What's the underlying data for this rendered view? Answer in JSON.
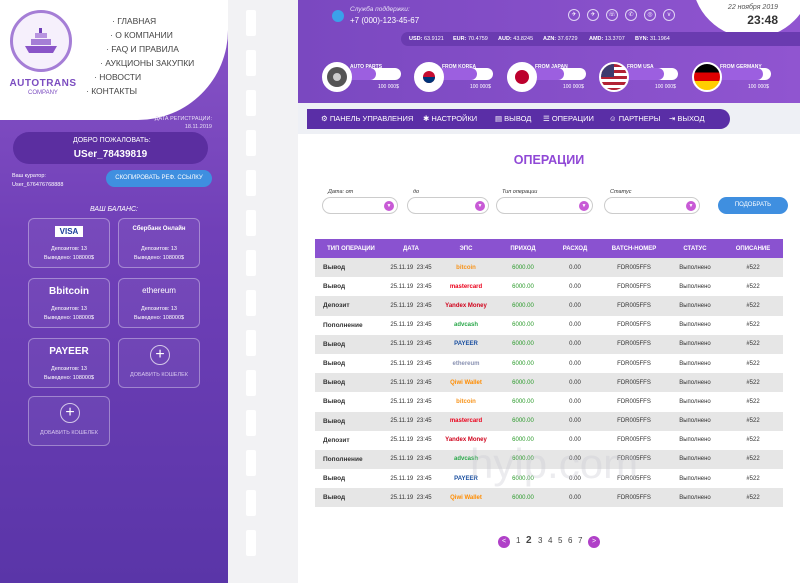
{
  "brand": {
    "title": "AUTOTRANS",
    "subtitle": "COMPANY"
  },
  "nav": [
    "· ГЛАВНАЯ",
    "· О КОМПАНИИ",
    "· FAQ И ПРАВИЛА",
    "· АУКЦИОНЫ ЗАКУПКИ",
    "· НОВОСТИ",
    "· КОНТАКТЫ"
  ],
  "account": {
    "reg_label": "ДАТА РЕГИСТРАЦИИ:",
    "reg_date": "18.11.2019",
    "welcome": "ДОБРО ПОЖАЛОВАТЬ:",
    "username": "USer_78439819",
    "curator_label": "Ваш куратор:",
    "curator": "User_676476768888",
    "copy_ref": "СКОПИРОВАТЬ РЕФ. ССЫЛКУ",
    "balance_label": "ВАШ БАЛАНС:"
  },
  "wallets": [
    {
      "logo": "VISA",
      "deposits": "Депозитов: 13",
      "withdrawn": "Выведено: 108000$"
    },
    {
      "logo": "Сбербанк Онлайн",
      "deposits": "Депозитов: 13",
      "withdrawn": "Выведено: 108000$"
    },
    {
      "logo": "Bbitcoin",
      "deposits": "Депозитов: 13",
      "withdrawn": "Выведено: 108000$"
    },
    {
      "logo": "ethereum",
      "deposits": "Депозитов: 13",
      "withdrawn": "Выведено: 108000$"
    },
    {
      "logo": "PAYEER",
      "deposits": "Депозитов: 13",
      "withdrawn": "Выведено: 108000$"
    }
  ],
  "add_wallet": "ДОБАВИТЬ КОШЕЛЕК",
  "support": {
    "label": "Служба поддержки:",
    "phone": "+7 (000)-123-45-67"
  },
  "socials": [
    "tg",
    "tg",
    "vb",
    "wa",
    "ig",
    "vk"
  ],
  "datetime": {
    "date": "22 ноября 2019",
    "time": "23:48"
  },
  "rates": [
    {
      "code": "USD:",
      "value": "63.9121"
    },
    {
      "code": "EUR:",
      "value": "70.4759"
    },
    {
      "code": "AUD:",
      "value": "43.8245"
    },
    {
      "code": "AZN:",
      "value": "37.6729"
    },
    {
      "code": "AMD:",
      "value": "13.3707"
    },
    {
      "code": "BYN:",
      "value": "31.1964"
    }
  ],
  "sources": [
    {
      "label": "AUTO PARTS",
      "value": "100 000$",
      "fill": 0.55
    },
    {
      "label": "FROM KOREA",
      "value": "100 000$",
      "fill": 0.7
    },
    {
      "label": "FROM JAPAN",
      "value": "100 000$",
      "fill": 0.6
    },
    {
      "label": "FROM USA",
      "value": "100 000$",
      "fill": 0.75
    },
    {
      "label": "FROM GERMANY",
      "value": "100 000$",
      "fill": 0.85
    }
  ],
  "menu": [
    "ПАНЕЛЬ УПРАВЛЕНИЯ",
    "НАСТРОЙКИ",
    "ВЫВОД",
    "ОПЕРАЦИИ",
    "ПАРТНЕРЫ",
    "ВЫХОД"
  ],
  "page_title": "ОПЕРАЦИИ",
  "filters": {
    "from": "Дата: от",
    "to": "до",
    "type": "Тип операции",
    "status": "Статус",
    "find": "ПОДОБРАТЬ"
  },
  "table": {
    "headers": [
      "ТИП ОПЕРАЦИИ",
      "ДАТА",
      "ЭПС",
      "ПРИХОД",
      "РАСХОД",
      "BATCH-НОМЕР",
      "СТАТУС",
      "ОПИСАНИЕ"
    ],
    "rows": [
      {
        "type": "Вывод",
        "date": "25.11.19",
        "time": "23:45",
        "eps": "bitcoin",
        "income": "6000.00",
        "expense": "0.00",
        "batch": "FDR005FFS",
        "status": "Выполнено",
        "desc": "#522"
      },
      {
        "type": "Вывод",
        "date": "25.11.19",
        "time": "23:45",
        "eps": "mastercard",
        "income": "6000.00",
        "expense": "0.00",
        "batch": "FDR005FFS",
        "status": "Выполнено",
        "desc": "#522"
      },
      {
        "type": "Депозит",
        "date": "25.11.19",
        "time": "23:45",
        "eps": "Yandex Money",
        "income": "6000.00",
        "expense": "0.00",
        "batch": "FDR005FFS",
        "status": "Выполнено",
        "desc": "#522"
      },
      {
        "type": "Пополнение",
        "date": "25.11.19",
        "time": "23:45",
        "eps": "advcash",
        "income": "6000.00",
        "expense": "0.00",
        "batch": "FDR005FFS",
        "status": "Выполнено",
        "desc": "#522"
      },
      {
        "type": "Вывод",
        "date": "25.11.19",
        "time": "23:45",
        "eps": "PAYEER",
        "income": "6000.00",
        "expense": "0.00",
        "batch": "FDR005FFS",
        "status": "Выполнено",
        "desc": "#522"
      },
      {
        "type": "Вывод",
        "date": "25.11.19",
        "time": "23:45",
        "eps": "ethereum",
        "income": "6000.00",
        "expense": "0.00",
        "batch": "FDR005FFS",
        "status": "Выполнено",
        "desc": "#522"
      },
      {
        "type": "Вывод",
        "date": "25.11.19",
        "time": "23:45",
        "eps": "Qiwi Wallet",
        "income": "6000.00",
        "expense": "0.00",
        "batch": "FDR005FFS",
        "status": "Выполнено",
        "desc": "#522"
      },
      {
        "type": "Вывод",
        "date": "25.11.19",
        "time": "23:45",
        "eps": "bitcoin",
        "income": "6000.00",
        "expense": "0.00",
        "batch": "FDR005FFS",
        "status": "Выполнено",
        "desc": "#522"
      },
      {
        "type": "Вывод",
        "date": "25.11.19",
        "time": "23:45",
        "eps": "mastercard",
        "income": "6000.00",
        "expense": "0.00",
        "batch": "FDR005FFS",
        "status": "Выполнено",
        "desc": "#522"
      },
      {
        "type": "Депозит",
        "date": "25.11.19",
        "time": "23:45",
        "eps": "Yandex Money",
        "income": "6000.00",
        "expense": "0.00",
        "batch": "FDR005FFS",
        "status": "Выполнено",
        "desc": "#522"
      },
      {
        "type": "Пополнение",
        "date": "25.11.19",
        "time": "23:45",
        "eps": "advcash",
        "income": "6000.00",
        "expense": "0.00",
        "batch": "FDR005FFS",
        "status": "Выполнено",
        "desc": "#522"
      },
      {
        "type": "Вывод",
        "date": "25.11.19",
        "time": "23:45",
        "eps": "PAYEER",
        "income": "6000.00",
        "expense": "0.00",
        "batch": "FDR005FFS",
        "status": "Выполнено",
        "desc": "#522"
      },
      {
        "type": "Вывод",
        "date": "25.11.19",
        "time": "23:45",
        "eps": "Qiwi Wallet",
        "income": "6000.00",
        "expense": "0.00",
        "batch": "FDR005FFS",
        "status": "Выполнено",
        "desc": "#522"
      }
    ]
  },
  "pagination": {
    "prev": "<",
    "pages": [
      "1",
      "2",
      "3",
      "4",
      "5",
      "6",
      "7"
    ],
    "current": "2",
    "next": ">"
  },
  "watermark": "hyip.com",
  "colors": {
    "accent": "#8a52d0",
    "button": "#3f8fe0",
    "income": "#2a9a2a"
  }
}
